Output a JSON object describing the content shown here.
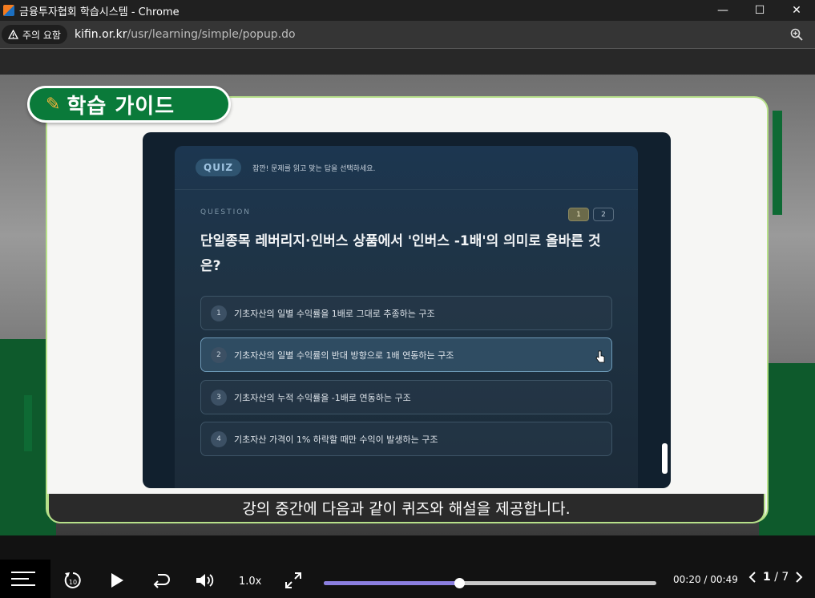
{
  "window": {
    "title": "금융투자협회 학습시스템 - Chrome",
    "controls": {
      "minimize": "—",
      "maximize": "☐",
      "close": "✕"
    }
  },
  "addressbar": {
    "warning_label": "주의 요함",
    "url_host": "kifin.or.kr",
    "url_path": "/usr/learning/simple/popup.do"
  },
  "guide": {
    "title": "학습 가이드"
  },
  "quiz": {
    "badge": "QUIZ",
    "hint": "잠깐! 문제를 읽고 맞는 답을 선택하세요.",
    "question_label": "QUESTION",
    "pages": [
      "1",
      "2"
    ],
    "active_page": 0,
    "question": "단일종목 레버리지·인버스 상품에서 '인버스 -1배'의 의미로 올바른 것은?",
    "options": [
      {
        "num": "1",
        "text": "기초자산의 일별 수익률을 1배로 그대로 추종하는 구조"
      },
      {
        "num": "2",
        "text": "기초자산의 일별 수익률의 반대 방향으로 1배 연동하는 구조"
      },
      {
        "num": "3",
        "text": "기초자산의 누적 수익률을 -1배로 연동하는 구조"
      },
      {
        "num": "4",
        "text": "기초자산 가격이 1% 하락할 때만 수익이 발생하는 구조"
      }
    ],
    "selected_option": 1
  },
  "subtitle": "강의 중간에 다음과 같이 퀴즈와 해설을 제공합니다.",
  "player": {
    "speed": "1.0x",
    "current_time": "00:20",
    "duration": "00:49",
    "progress": 0.408,
    "page_current": "1",
    "page_total": "7",
    "accent_color": "#8b7fe0"
  }
}
